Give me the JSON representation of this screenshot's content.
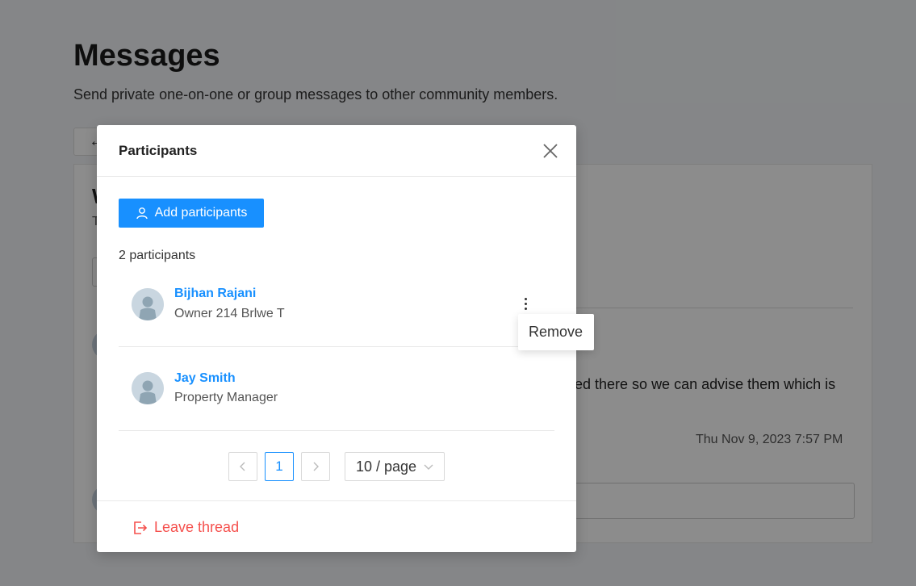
{
  "page": {
    "title": "Messages",
    "subtitle": "Send private one-on-one or group messages to other community members.",
    "message_fragment": "ed there so we can advise them which is",
    "timestamp": "Thu Nov 9, 2023 7:57 PM"
  },
  "modal": {
    "title": "Participants",
    "add_label": "Add participants",
    "count_label": "2 participants",
    "participants": [
      {
        "name": "Bijhan Rajani",
        "role": "Owner 214 Brlwe T"
      },
      {
        "name": "Jay Smith",
        "role": "Property Manager"
      }
    ],
    "menu": {
      "remove_label": "Remove"
    },
    "pagination": {
      "current_page": "1",
      "page_size": "10 / page"
    },
    "leave_label": "Leave thread"
  },
  "colors": {
    "accent": "#1890ff",
    "danger": "#f5504d"
  }
}
